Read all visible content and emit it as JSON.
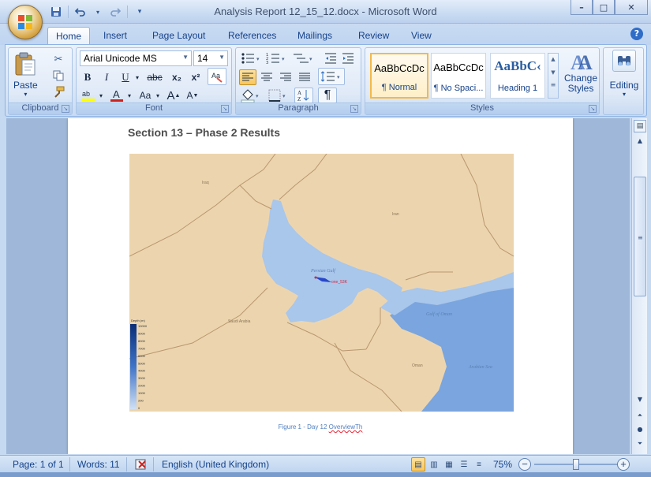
{
  "window": {
    "title": "Analysis Report 12_15_12.docx - Microsoft Word",
    "minimize": "–",
    "maximize": "□",
    "close": "✕"
  },
  "quick_access": {
    "save_icon": "save-icon",
    "undo_icon": "undo-icon",
    "redo_icon": "redo-icon"
  },
  "tabs": [
    {
      "label": "Home",
      "active": true
    },
    {
      "label": "Insert"
    },
    {
      "label": "Page Layout"
    },
    {
      "label": "References"
    },
    {
      "label": "Mailings"
    },
    {
      "label": "Review"
    },
    {
      "label": "View"
    }
  ],
  "ribbon": {
    "clipboard": {
      "label": "Clipboard",
      "paste": "Paste"
    },
    "font": {
      "label": "Font",
      "font_name": "Arial Unicode MS",
      "font_size": "14",
      "bold": "B",
      "italic": "I",
      "underline": "U",
      "strike": "abc",
      "subscript": "x₂",
      "superscript": "x²",
      "case": "Aa",
      "grow": "A",
      "shrink": "A"
    },
    "paragraph": {
      "label": "Paragraph"
    },
    "styles": {
      "label": "Styles",
      "items": [
        {
          "sample": "AaBbCcDc",
          "name": "¶ Normal",
          "selected": true
        },
        {
          "sample": "AaBbCcDc",
          "name": "¶ No Spaci..."
        },
        {
          "sample": "AaBbC‹",
          "name": "Heading 1"
        }
      ],
      "change_styles": "Change Styles"
    },
    "editing": {
      "label": "Editing"
    }
  },
  "document": {
    "section_title": "Section 13 – Phase 2 Results",
    "caption_prefix": "Figure 1 - Day 12 ",
    "caption_word": "OverviewTh",
    "map": {
      "labels": {
        "iraq": "Iraq",
        "iran": "Iran",
        "saudi": "Saudi Arabia",
        "oman": "Oman",
        "gulf": "Persian Gulf",
        "gulf_oman": "Gulf of Oman",
        "arabian_sea": "Arabian Sea",
        "marker": "one_53K"
      },
      "legend_title": "Depth (m)",
      "legend_values": [
        "10000",
        "9000",
        "8000",
        "7000",
        "6000",
        "5000",
        "4000",
        "3000",
        "2000",
        "1000",
        "200",
        "0"
      ],
      "colors": {
        "land": "#ecd5ae",
        "shallow": "#a9c6eb",
        "deep": "#7aa5de",
        "border": "#b99670"
      }
    }
  },
  "status": {
    "page": "Page: 1 of 1",
    "words": "Words: 11",
    "language": "English (United Kingdom)",
    "zoom": "75%",
    "zoom_level": 0.5
  }
}
